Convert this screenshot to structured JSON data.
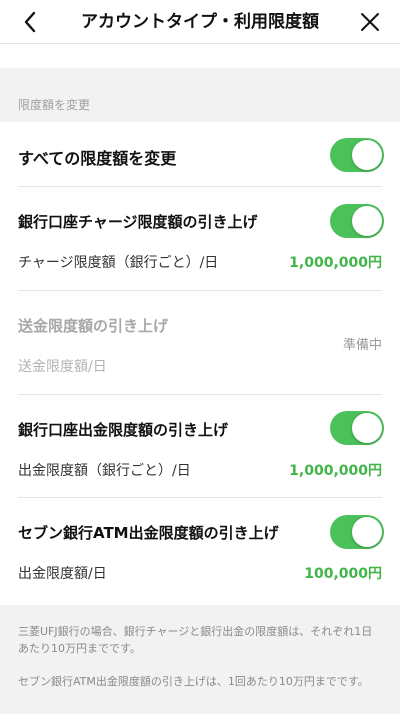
{
  "header": {
    "title": "アカウントタイプ・利用限度額",
    "back_icon": "chevron-left-icon",
    "close_icon": "close-icon"
  },
  "section_label": "限度額を変更",
  "rows": {
    "all_limits": {
      "title": "すべての限度額を変更",
      "toggle_on": true
    },
    "bank_charge": {
      "title": "銀行口座チャージ限度額の引き上げ",
      "toggle_on": true,
      "sub_label": "チャージ限度額（銀行ごと）/日",
      "amount": "1,000,000円"
    },
    "transfer": {
      "title": "送金限度額の引き上げ",
      "status": "準備中",
      "sub_label": "送金限度額/日"
    },
    "bank_withdraw": {
      "title": "銀行口座出金限度額の引き上げ",
      "toggle_on": true,
      "sub_label": "出金限度額（銀行ごと）/日",
      "amount": "1,000,000円"
    },
    "seven_atm": {
      "title": "セブン銀行ATM出金限度額の引き上げ",
      "toggle_on": true,
      "sub_label": "出金限度額/日",
      "amount": "100,000円"
    }
  },
  "notes": [
    "三菱UFJ銀行の場合、銀行チャージと銀行出金の限度額は、それぞれ1日あたり10万円までです。",
    "セブン銀行ATM出金限度額の引き上げは、1回あたり10万円までです。"
  ],
  "colors": {
    "accent_green": "#42b549",
    "toggle_green": "#4cc15a",
    "background": "#f2f2f3"
  }
}
